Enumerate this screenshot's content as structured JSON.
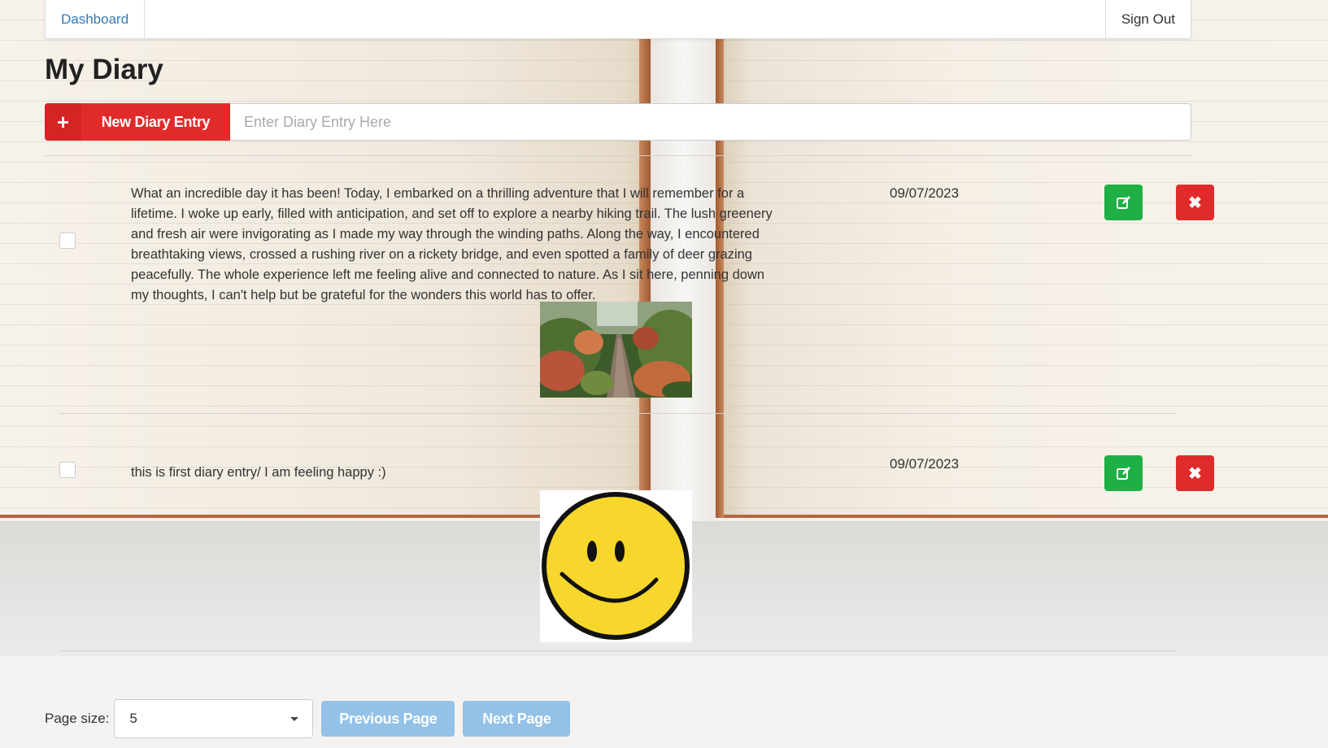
{
  "nav": {
    "dashboard": "Dashboard",
    "sign_out": "Sign Out"
  },
  "page": {
    "title": "My Diary"
  },
  "new_entry": {
    "button_label": "New Diary Entry",
    "plus_icon": "plus-icon",
    "placeholder": "Enter Diary Entry Here",
    "value": ""
  },
  "entries": [
    {
      "text": "What an incredible day it has been! Today, I embarked on a thrilling adventure that I will remember for a lifetime. I woke up early, filled with anticipation, and set off to explore a nearby hiking trail. The lush greenery and fresh air were invigorating as I made my way through the winding paths. Along the way, I encountered breathtaking views, crossed a rushing river on a rickety bridge, and even spotted a family of deer grazing peacefully. The whole experience left me feeling alive and connected to nature. As I sit here, penning down my thoughts, I can't help but be grateful for the wonders this world has to offer.",
      "date": "09/07/2023",
      "checked": false,
      "image": "forest-trail-photo"
    },
    {
      "text": "this is first diary entry/ I am feeling happy :)",
      "date": "09/07/2023",
      "checked": false,
      "image": "smiley-face-image"
    }
  ],
  "icons": {
    "edit": "edit-icon",
    "delete": "delete-icon"
  },
  "colors": {
    "primary_red": "#e02b2b",
    "edit_green": "#1fb045",
    "pager_blue": "#93c1e8",
    "link_blue": "#337ab7"
  },
  "pager": {
    "page_size_label": "Page size:",
    "page_size_value": "5",
    "prev_label": "Previous Page",
    "next_label": "Next Page"
  }
}
